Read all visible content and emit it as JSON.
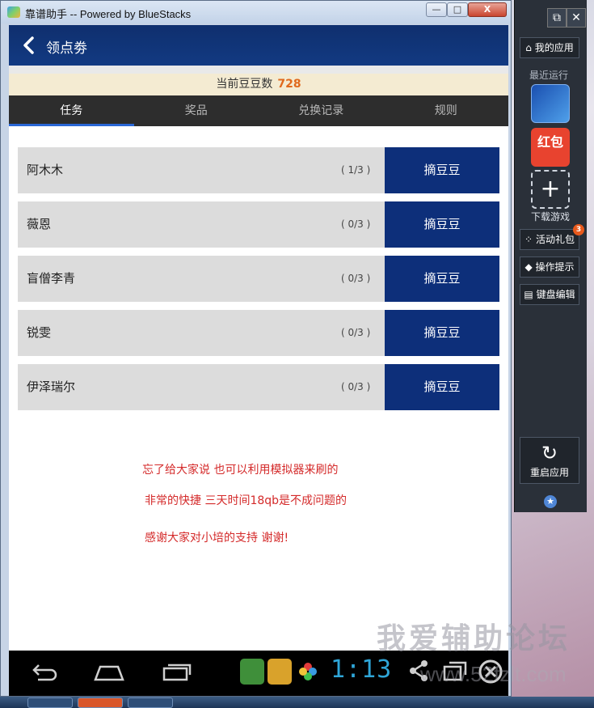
{
  "window": {
    "title": "靠谱助手  -- Powered by BlueStacks",
    "min_label": "—",
    "max_label": "□",
    "close_label": "X"
  },
  "header": {
    "back_icon": "chevron-left-icon",
    "title": "领点劵"
  },
  "beans": {
    "label": "当前豆豆数",
    "count": "728"
  },
  "tabs": [
    {
      "label": "任务",
      "active": true
    },
    {
      "label": "奖品",
      "active": false
    },
    {
      "label": "兑换记录",
      "active": false
    },
    {
      "label": "规则",
      "active": false
    }
  ],
  "tasks": [
    {
      "name": "阿木木",
      "progress": "( 1/3 )",
      "button": "摘豆豆"
    },
    {
      "name": "薇恩",
      "progress": "( 0/3 )",
      "button": "摘豆豆"
    },
    {
      "name": "盲僧李青",
      "progress": "( 0/3 )",
      "button": "摘豆豆"
    },
    {
      "name": "锐雯",
      "progress": "( 0/3 )",
      "button": "摘豆豆"
    },
    {
      "name": "伊泽瑞尔",
      "progress": "( 0/3 )",
      "button": "摘豆豆"
    }
  ],
  "notes": [
    "忘了给大家说 也可以利用模拟器来刷的",
    "非常的快捷 三天时间18qb是不成问题的",
    "感谢大家对小培的支持 谢谢!"
  ],
  "navbar": {
    "clock": "1:13"
  },
  "sidebar": {
    "my_apps": "我的应用",
    "recent_label": "最近运行",
    "hongbao_label": "红包",
    "download_label": "下载游戏",
    "gift_label": "活动礼包",
    "gift_badge": "3",
    "tips_label": "操作提示",
    "keyboard_label": "键盘编辑",
    "restart_label": "重启应用"
  },
  "watermark": {
    "main": "我爱辅助论坛",
    "sub": "www.52fzlt.com"
  },
  "colors": {
    "header_blue": "#123a82",
    "button_blue": "#0d2f7a",
    "tab_active_underline": "#2a67d6",
    "bean_count_orange": "#e0691c",
    "note_red": "#d42a2a",
    "clock_blue": "#2fa6d8"
  }
}
